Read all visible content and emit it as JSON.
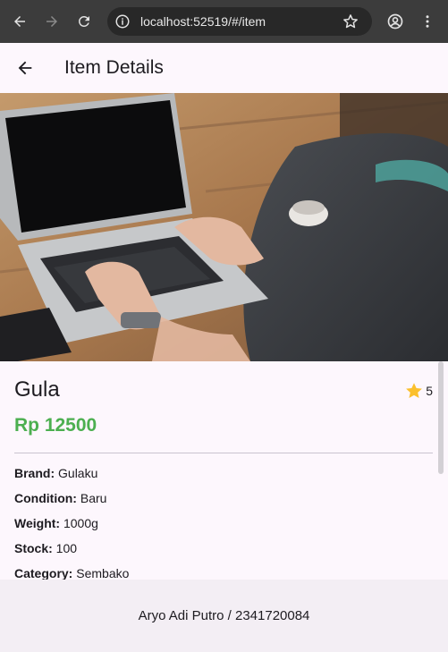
{
  "browser": {
    "url": "localhost:52519/#/item",
    "icons": [
      "back-arrow-icon",
      "forward-arrow-icon",
      "reload-icon",
      "info-icon",
      "star-icon",
      "account-icon",
      "more-vert-icon"
    ]
  },
  "appbar": {
    "title": "Item Details",
    "back_icon": "arrow-back-icon"
  },
  "item": {
    "name": "Gula",
    "rating": "5",
    "price": "Rp 12500",
    "attributes": [
      {
        "label": "Brand:",
        "value": " Gulaku"
      },
      {
        "label": "Condition:",
        "value": " Baru"
      },
      {
        "label": "Weight:",
        "value": " 1000g"
      },
      {
        "label": "Stock:",
        "value": " 100"
      },
      {
        "label": "Category:",
        "value": " Sembako"
      }
    ]
  },
  "footer": {
    "text": "Aryo Adi Putro / 2341720084"
  },
  "colors": {
    "price": "#4caf50",
    "star": "#fbc02d",
    "background": "#fdf7fd",
    "footer": "#f3eef4"
  }
}
